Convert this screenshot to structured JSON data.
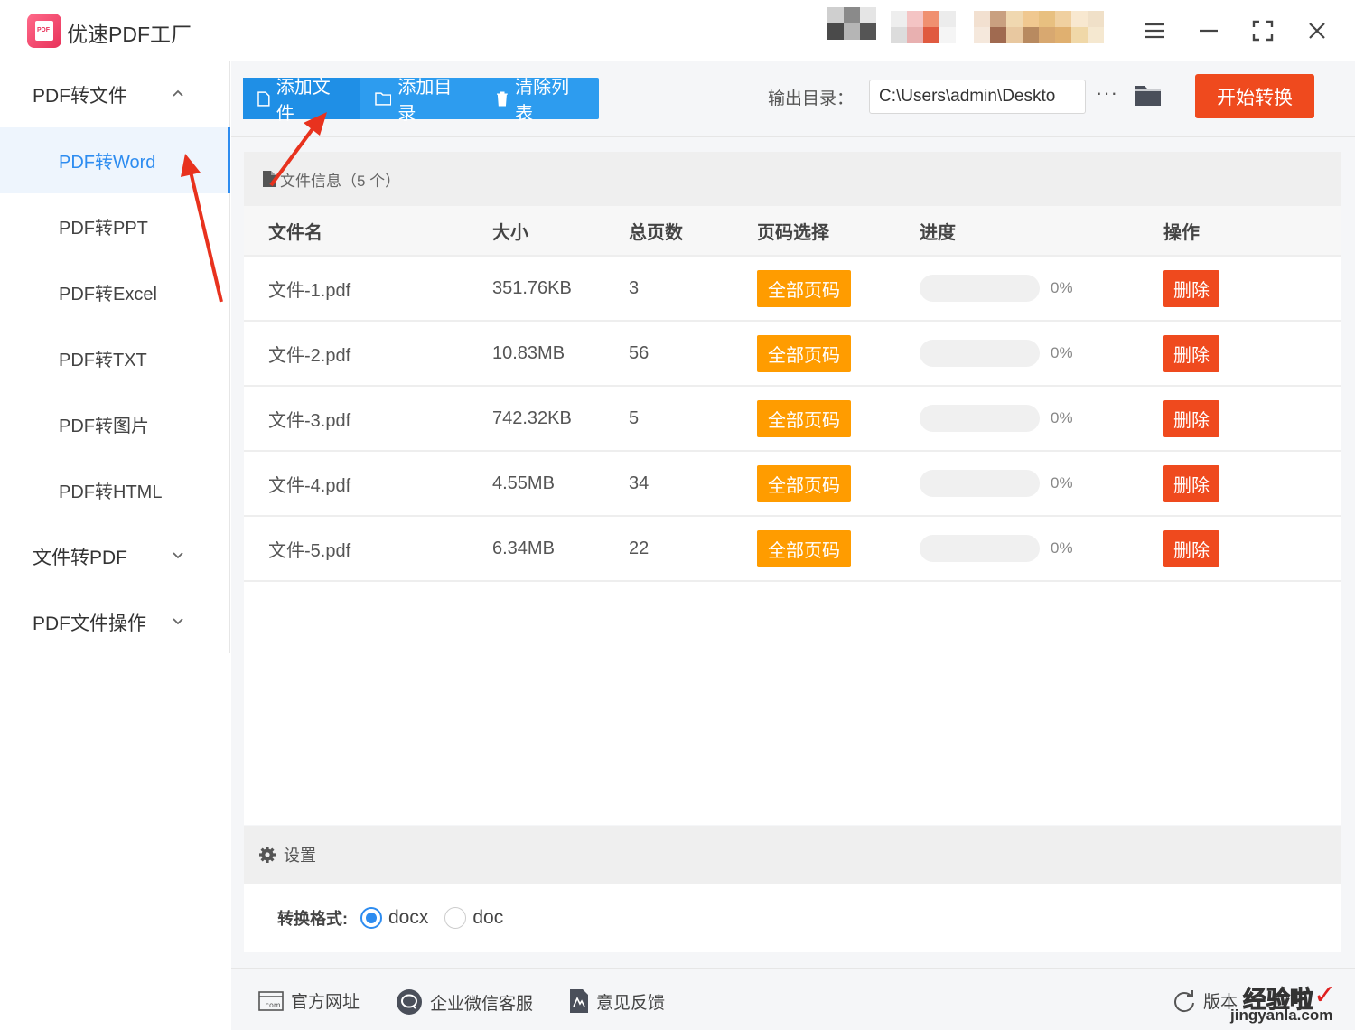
{
  "app": {
    "title": "优速PDF工厂",
    "logo_text": "PDF"
  },
  "window_controls": [
    "menu-icon",
    "minimize-icon",
    "fullscreen-icon",
    "close-icon"
  ],
  "sidebar": {
    "groups": [
      {
        "label": "PDF转文件",
        "expanded": true,
        "items": [
          "PDF转Word",
          "PDF转PPT",
          "PDF转Excel",
          "PDF转TXT",
          "PDF转图片",
          "PDF转HTML"
        ],
        "active_item": "PDF转Word"
      },
      {
        "label": "文件转PDF",
        "expanded": false
      },
      {
        "label": "PDF文件操作",
        "expanded": false
      }
    ]
  },
  "toolbar": {
    "add_file": "添加文件",
    "add_dir": "添加目录",
    "clear_list": "清除列表",
    "output_label": "输出目录：",
    "output_path": "C:\\Users\\admin\\Deskto",
    "more": "···",
    "start": "开始转换"
  },
  "files": {
    "header": "文件信息（5 个）",
    "columns": [
      "文件名",
      "大小",
      "总页数",
      "页码选择",
      "进度",
      "操作"
    ],
    "rows": [
      {
        "name": "文件-1.pdf",
        "size": "351.76KB",
        "pages": "3",
        "page_select": "全部页码",
        "progress": 0,
        "progress_text": "0%",
        "action": "删除"
      },
      {
        "name": "文件-2.pdf",
        "size": "10.83MB",
        "pages": "56",
        "page_select": "全部页码",
        "progress": 0,
        "progress_text": "0%",
        "action": "删除"
      },
      {
        "name": "文件-3.pdf",
        "size": "742.32KB",
        "pages": "5",
        "page_select": "全部页码",
        "progress": 0,
        "progress_text": "0%",
        "action": "删除"
      },
      {
        "name": "文件-4.pdf",
        "size": "4.55MB",
        "pages": "34",
        "page_select": "全部页码",
        "progress": 0,
        "progress_text": "0%",
        "action": "删除"
      },
      {
        "name": "文件-5.pdf",
        "size": "6.34MB",
        "pages": "22",
        "page_select": "全部页码",
        "progress": 0,
        "progress_text": "0%",
        "action": "删除"
      }
    ]
  },
  "settings": {
    "title": "设置",
    "format_label": "转换格式:",
    "options": [
      "docx",
      "doc"
    ],
    "selected": "docx"
  },
  "footer": {
    "website": "官方网址",
    "wechat": "企业微信客服",
    "feedback": "意见反馈",
    "version": "版本"
  },
  "watermark": {
    "text": "经验啦",
    "url": "jingyanla.com"
  },
  "colors": {
    "accent": "#2d8cf0",
    "toolbar": "#2d9cef",
    "start": "#ef4a1e",
    "page_select": "#ff9c00",
    "delete": "#ef4a1e",
    "annotation": "#e8321e"
  }
}
